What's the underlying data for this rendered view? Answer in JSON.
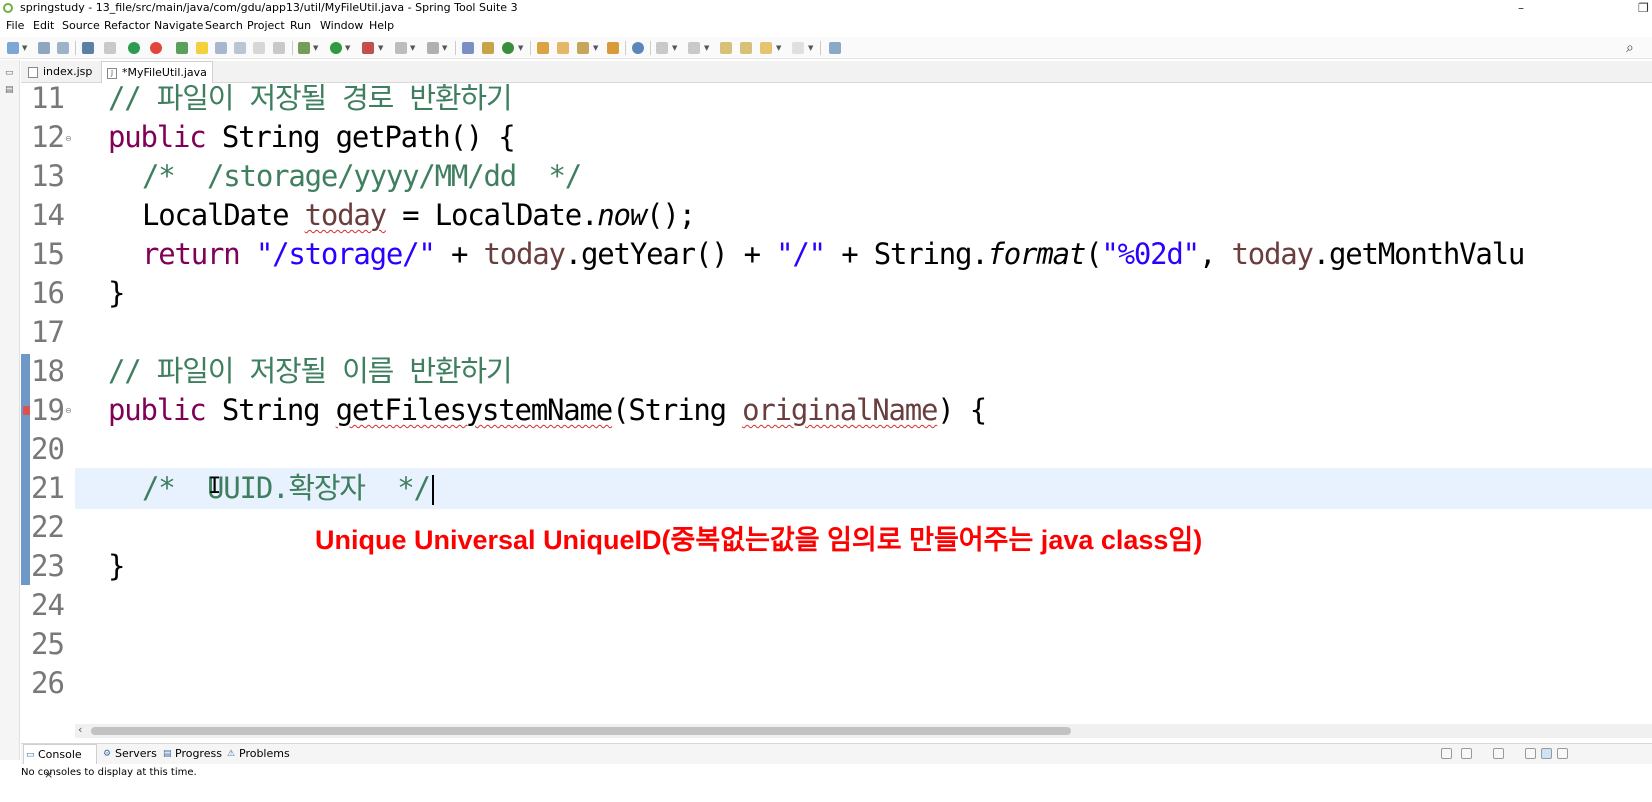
{
  "window": {
    "title": "springstudy - 13_file/src/main/java/com/gdu/app13/util/MyFileUtil.java - Spring Tool Suite 3",
    "minimize_glyph": "–",
    "restore_glyph": "❐"
  },
  "menu": [
    "File",
    "Edit",
    "Source",
    "Refactor",
    "Navigate",
    "Search",
    "Project",
    "Run",
    "Window",
    "Help"
  ],
  "editor_tabs": [
    {
      "label": "index.jsp",
      "active": false
    },
    {
      "label": "*MyFileUtil.java",
      "active": true,
      "close": "×"
    }
  ],
  "line_numbers": [
    "11",
    "12",
    "13",
    "14",
    "15",
    "16",
    "17",
    "18",
    "19",
    "20",
    "21",
    "22",
    "23",
    "24",
    "25",
    "26"
  ],
  "code": {
    "l11": {
      "comment": "// 파일이 저장될 경로 반환하기"
    },
    "l12": {
      "kw": "public",
      "rest": " String getPath() {"
    },
    "l13": {
      "comment": "/*  /storage/yyyy/MM/dd  */"
    },
    "l14": {
      "a": "LocalDate ",
      "var": "today",
      "b": " = LocalDate.",
      "method": "now",
      "c": "();"
    },
    "l15": {
      "kw": "return",
      "s1": "\"/storage/\"",
      "p1": " + ",
      "var1": "today",
      "p2": ".getYear() + ",
      "s2": "\"/\"",
      "p3": " + String.",
      "method": "format",
      "p4": "(",
      "s3": "\"%02d\"",
      "p5": ", ",
      "var2": "today",
      "p6": ".getMonthValu"
    },
    "l16": {
      "text": "}"
    },
    "l18": {
      "comment": "// 파일이 저장될 이름 반환하기"
    },
    "l19": {
      "kw": "public",
      "a": " String ",
      "method": "getFilesystemName",
      "b": "(String ",
      "param": "originalName",
      "c": ") {"
    },
    "l21": {
      "comment": "/*  UUID.확장자  */"
    },
    "l23": {
      "text": "}"
    }
  },
  "annotation": "Unique Universal UniqueID(중복없는값을 임의로 만들어주는 java class임)",
  "bottom_tabs": [
    {
      "label": "Console",
      "icon": "▭",
      "active": true,
      "close": "×"
    },
    {
      "label": "Servers",
      "icon": "⚙",
      "active": false
    },
    {
      "label": "Progress",
      "icon": "▤",
      "active": false
    },
    {
      "label": "Problems",
      "icon": "⚠",
      "active": false
    }
  ],
  "console_message": "No consoles to display at this time.",
  "colors": {
    "keyword": "#7f0055",
    "comment": "#3f7f5f",
    "string": "#2a00ff",
    "variable": "#6a3e3e",
    "annotation": "#ff0000",
    "current_line": "#e8f2fe",
    "change_bar": "#6f98c9"
  }
}
